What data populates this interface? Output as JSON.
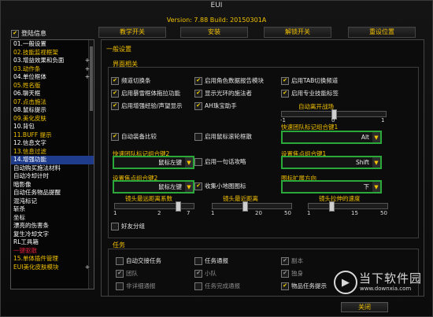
{
  "app_title": "EUI",
  "version_line": "Version: 7.88 Build: 20150301A",
  "auto_login_label": "登陆信息",
  "top_buttons": [
    "教学开关",
    "安装",
    "解锁开关",
    "重设位置"
  ],
  "sidebar": {
    "items": [
      {
        "label": "01.一般设置",
        "color": "#ffffff",
        "plus": false
      },
      {
        "label": "02.技能监视框架",
        "color": "#f2c200",
        "plus": false
      },
      {
        "label": "03.增益效果和负面",
        "color": "#ffffff",
        "plus": true
      },
      {
        "label": "03.动作条",
        "color": "#f2c200",
        "plus": true
      },
      {
        "label": "04.单位框体",
        "color": "#ffffff",
        "plus": true
      },
      {
        "label": "05.姓名版",
        "color": "#f2c200",
        "plus": false
      },
      {
        "label": "06.聊天框",
        "color": "#ffffff",
        "plus": false
      },
      {
        "label": "07.点击施法",
        "color": "#f2c200",
        "plus": false
      },
      {
        "label": "08.鼠标提示",
        "color": "#ffffff",
        "plus": false
      },
      {
        "label": "09.美化皮肤",
        "color": "#f2c200",
        "plus": false
      },
      {
        "label": "10.背包",
        "color": "#ffffff",
        "plus": false
      },
      {
        "label": "11.BUFF 提示",
        "color": "#f2c200",
        "plus": false
      },
      {
        "label": "12.信息文字",
        "color": "#ffffff",
        "plus": false
      },
      {
        "label": "13.信息过滤",
        "color": "#f2c200",
        "plus": false
      },
      {
        "label": "14.增强功能",
        "color": "#ffffff",
        "plus": false,
        "selected": true
      },
      {
        "label": "自动购买施法材料",
        "color": "#ffffff",
        "plus": false
      },
      {
        "label": "自动冷却计时",
        "color": "#ffffff",
        "plus": false
      },
      {
        "label": "暗影像",
        "color": "#ffffff",
        "plus": false
      },
      {
        "label": "自动任务物品提醒",
        "color": "#ffffff",
        "plus": false
      },
      {
        "label": "混沌标记",
        "color": "#ffffff",
        "plus": false
      },
      {
        "label": "斩杀",
        "color": "#ffffff",
        "plus": false
      },
      {
        "label": "坐标",
        "color": "#ffffff",
        "plus": false
      },
      {
        "label": "漂亮的伤害条",
        "color": "#ffffff",
        "plus": false
      },
      {
        "label": "复生冷却文字",
        "color": "#ffffff",
        "plus": false
      },
      {
        "label": "RL工具箱",
        "color": "#ffffff",
        "plus": false
      },
      {
        "label": "一键驱散",
        "color": "#e0203a",
        "plus": false
      },
      {
        "label": "15.单体插件管理",
        "color": "#f2c200",
        "plus": false
      },
      {
        "label": "EUI美化皮肤模块",
        "color": "#f2c200",
        "plus": true
      }
    ]
  },
  "panel": {
    "section_general": "一般设置",
    "section_ui": "界面相关",
    "section_task": "任务",
    "checks": [
      {
        "label": "频道切换条",
        "checked": true
      },
      {
        "label": "启用角色数据报告模块",
        "checked": true
      },
      {
        "label": "启用TAB切换频道",
        "checked": true
      },
      {
        "label": "启用暴雪框体拖拉功能",
        "checked": true
      },
      {
        "label": "显示光环的施法者",
        "checked": true
      },
      {
        "label": "启用专业技能标签",
        "checked": true
      },
      {
        "label": "启用增强经验/声望显示",
        "checked": true
      },
      {
        "label": "AH珠宝助手",
        "checked": true
      },
      {
        "label": "自动装备比较",
        "checked": true
      },
      {
        "label": "启用鼠标滚轮框散",
        "checked": false
      },
      {
        "label": "启用一句话攻略",
        "checked": false
      },
      {
        "label": "收集小地图图标",
        "checked": true
      },
      {
        "label": "好友分组",
        "checked": false
      }
    ],
    "auto_leave_label": "自动离开战场",
    "auto_leave_slider": {
      "min": "-1",
      "mid": "0",
      "max": "1",
      "value_fraction": 0.5
    },
    "dropdowns": [
      {
        "label": "快速团队标记组合键1",
        "value": "Alt"
      },
      {
        "label": "快速团队标记组合键2",
        "value": "鼠标左键"
      },
      {
        "label": "设置焦点组合键1",
        "value": "Shift"
      },
      {
        "label": "设置焦点组合键2",
        "value": "鼠标左键"
      },
      {
        "label": "图标扩展方向",
        "value": "下"
      }
    ],
    "sliders": [
      {
        "label": "镜头最远距离系数",
        "min": "1",
        "mid": "2",
        "max": "7",
        "value_fraction": 0.82
      },
      {
        "label": "镜头最近距离",
        "min": "1",
        "mid": "20",
        "max": "50",
        "value_fraction": 0.4
      },
      {
        "label": "镜头拉伸的速度",
        "min": "1",
        "mid": "15",
        "max": "50",
        "value_fraction": 0.28
      }
    ],
    "task_checks": [
      {
        "label": "自动交接任务",
        "checked": false,
        "grey": false
      },
      {
        "label": "任务通报",
        "checked": false,
        "grey": false
      },
      {
        "label": "副本",
        "checked": true,
        "grey": true
      },
      {
        "label": "团队",
        "checked": true,
        "grey": true
      },
      {
        "label": "小队",
        "checked": true,
        "grey": true
      },
      {
        "label": "独身",
        "checked": true,
        "grey": true
      },
      {
        "label": "非详细通报",
        "checked": false,
        "grey": true
      },
      {
        "label": "任务完成通报",
        "checked": false,
        "grey": true
      },
      {
        "label": "物品任务提示",
        "checked": true,
        "grey": false
      }
    ]
  },
  "close_label": "关闭",
  "watermark": {
    "cn": "当下软件园",
    "url": "www.downxia.com"
  }
}
